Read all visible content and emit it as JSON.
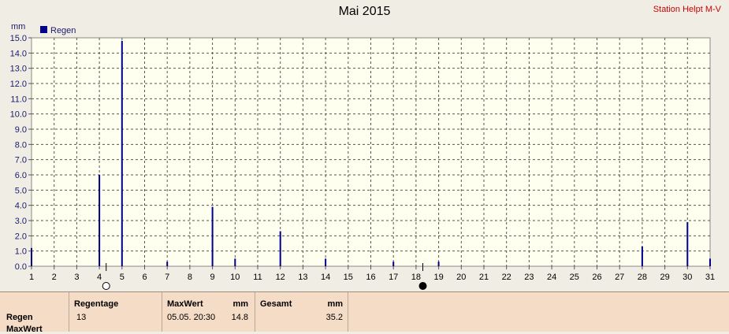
{
  "title": "Mai 2015",
  "station": "Station Helpt M-V",
  "chart_data": {
    "type": "bar",
    "title": "Mai 2015",
    "ylabel": "mm",
    "ylim": [
      0,
      15
    ],
    "yticks": [
      "0.0",
      "1.0",
      "2.0",
      "3.0",
      "4.0",
      "5.0",
      "6.0",
      "7.0",
      "8.0",
      "9.0",
      "10.0",
      "11.0",
      "12.0",
      "13.0",
      "14.0",
      "15.0"
    ],
    "xlim": [
      1,
      31
    ],
    "x_ticks": [
      "1",
      "2",
      "3",
      "4",
      "5",
      "6",
      "7",
      "8",
      "9",
      "10",
      "11",
      "12",
      "13",
      "14",
      "15",
      "16",
      "17",
      "18",
      "19",
      "20",
      "21",
      "22",
      "23",
      "24",
      "25",
      "26",
      "27",
      "28",
      "29",
      "30",
      "31"
    ],
    "grid": true,
    "legend": "top-left",
    "series": [
      {
        "name": "Regen",
        "color": "#00008b",
        "points": [
          {
            "x": 1,
            "y": 1.2
          },
          {
            "x": 4,
            "y": 6.0
          },
          {
            "x": 5,
            "y": 14.8
          },
          {
            "x": 7,
            "y": 0.3
          },
          {
            "x": 9,
            "y": 3.9
          },
          {
            "x": 10,
            "y": 0.5
          },
          {
            "x": 12,
            "y": 2.3
          },
          {
            "x": 14,
            "y": 0.5
          },
          {
            "x": 17,
            "y": 0.3
          },
          {
            "x": 19,
            "y": 0.3
          },
          {
            "x": 28,
            "y": 1.3
          },
          {
            "x": 30,
            "y": 2.9
          },
          {
            "x": 31,
            "y": 0.5
          }
        ]
      }
    ],
    "moon_phases": [
      {
        "x": 4.3,
        "phase": "full-moon"
      },
      {
        "x": 18.3,
        "phase": "new-moon"
      }
    ]
  },
  "panel": {
    "row_labels": [
      "Regen",
      "MaxWert"
    ],
    "regentage": {
      "header": "Regentage",
      "value": "13"
    },
    "maxwert": {
      "header": "MaxWert",
      "unit": "mm",
      "datetime": "05.05.  20:30",
      "value": "14.8"
    },
    "gesamt": {
      "header": "Gesamt",
      "unit": "mm",
      "value": "35.2"
    }
  }
}
